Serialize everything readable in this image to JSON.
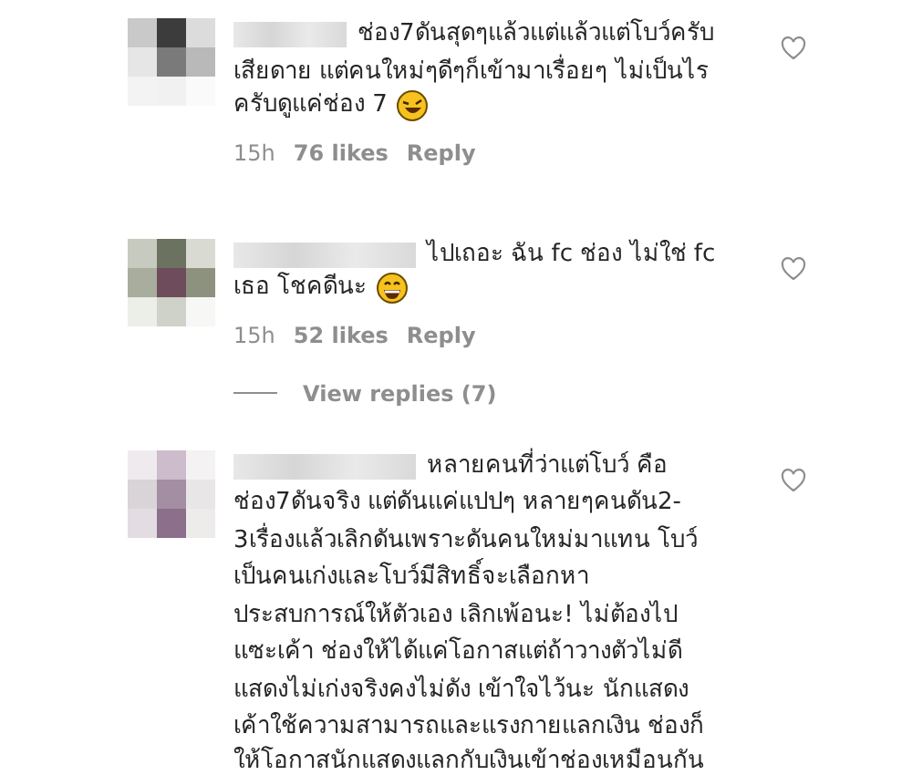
{
  "comments": [
    {
      "text": "ช่อง7ดันสุดๆแล้วแต่แล้วแต่โบว์ครับ\nเสียดาย แต่คนใหม่ๆดีๆก็เข้ามาเรื่อยๆ ไม่เป็นไร\nครับดูแค่ช่อง 7",
      "emoji": {
        "kind": "rofl"
      },
      "time": "15h",
      "likes": "76 likes",
      "reply": "Reply",
      "liked": false
    },
    {
      "text": "ไปเถอะ ฉัน fc ช่อง ไม่ใช่ fc\nเธอ โชคดีนะ",
      "emoji": {
        "kind": "grin"
      },
      "time": "15h",
      "likes": "52 likes",
      "reply": "Reply",
      "liked": false,
      "view_replies": "View replies (7)"
    },
    {
      "text": "หลายคนที่ว่าแต่โบว์ คือ\nช่อง7ดันจริง แต่ดันแค่แปปๆ หลายๆคนดัน2-\n3เรื่องแล้วเลิกดันเพราะดันคนใหม่มาแทน โบว์\nเป็นคนเก่งและโบว์มีสิทธิ์จะเลือกหา\nประสบการณ์ให้ตัวเอง เลิกเพ้อนะ! ไม่ต้องไป\nแซะเค้า ช่องให้ได้แค่โอกาสแต่ถ้าวางตัวไม่ดี\nแสดงไม่เก่งจริงคงไม่ดัง เข้าใจไว้นะ นักแสดง\nเค้าใช้ความสามารถและแรงกายแลกเงิน ช่องก็\nให้โอกาสนักแสดงแลกกับเงินเข้าช่องเหมือนกัน",
      "liked": false
    }
  ]
}
